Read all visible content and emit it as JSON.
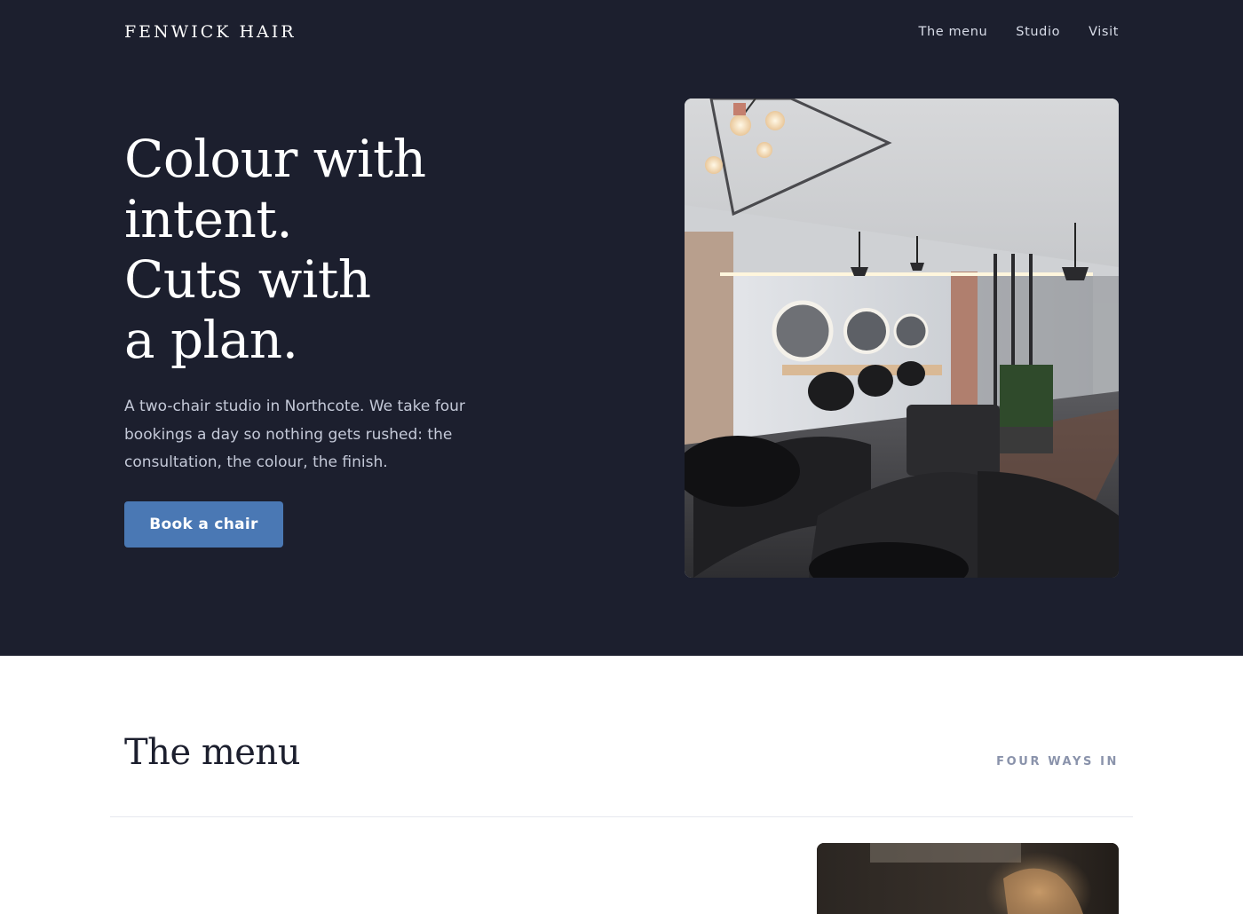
{
  "brand": {
    "name": "FENWICK HAIR"
  },
  "nav": {
    "links": [
      {
        "label": "The menu"
      },
      {
        "label": "Studio"
      },
      {
        "label": "Visit"
      }
    ]
  },
  "hero": {
    "headline_lines": [
      "Colour with",
      "intent.",
      "Cuts with",
      "a plan."
    ],
    "lede": "A two-chair studio in Northcote. We take four bookings a day so nothing gets rushed: the consultation, the colour, the finish.",
    "cta_label": "Book a chair",
    "photo": "salon-interior-photo"
  },
  "menu": {
    "title": "The menu",
    "kicker": "FOUR WAYS IN",
    "photo": "hair-styling-photo"
  },
  "colors": {
    "hero_background": "#1c1f2e",
    "accent": "#4a78b4",
    "kicker": "#8a93ab"
  }
}
